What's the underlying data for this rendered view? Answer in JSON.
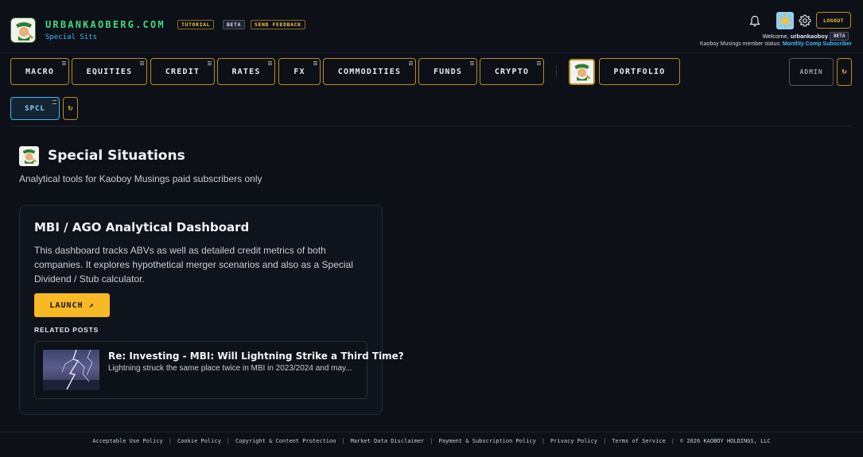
{
  "header": {
    "brand_title": "URBANKAOBERG.COM",
    "brand_subtitle": "Special Sits",
    "badges": {
      "tutorial": "TUTORIAL",
      "beta": "BETA",
      "feedback": "SEND FEEDBACK"
    },
    "logout_label": "LOGOUT",
    "welcome_prefix": "Welcome, ",
    "username": "urbankaoboy",
    "user_badge": "BETA",
    "member_status_prefix": "Kaoboy Musings member status: ",
    "member_status": "Monthly Comp Subscriber",
    "icons": [
      "bell-icon",
      "sun-icon",
      "gear-icon"
    ]
  },
  "nav": {
    "items": [
      "MACRO",
      "EQUITIES",
      "CREDIT",
      "RATES",
      "FX",
      "COMMODITIES",
      "FUNDS",
      "CRYPTO"
    ],
    "portfolio": "PORTFOLIO",
    "admin": "ADMIN",
    "refresh_glyph": "↻"
  },
  "subnav": {
    "active_tab": "SPCL",
    "refresh_glyph": "↻"
  },
  "page": {
    "title": "Special Situations",
    "description": "Analytical tools for Kaoboy Musings paid subscribers only"
  },
  "card": {
    "title": "MBI / AGO Analytical Dashboard",
    "description": "This dashboard tracks ABVs as well as detailed credit metrics of both companies. It explores hypothetical merger scenarios and also as a Special Dividend / Stub calculator.",
    "launch_label": "LAUNCH ↗",
    "related_heading": "RELATED POSTS",
    "post": {
      "title": "Re: Investing - MBI: Will Lightning Strike a Third Time?",
      "excerpt": "Lightning struck the same place twice in MBI in 2023/2024 and may..."
    }
  },
  "footer": {
    "links": [
      "Acceptable Use Policy",
      "Cookie Policy",
      "Copyright & Content Protection",
      "Market Data Disclaimer",
      "Payment & Subscription Policy",
      "Privacy Policy",
      "Terms of Service"
    ],
    "copyright": "© 2026 KAOBOY HOLDINGS, LLC",
    "separator": "|"
  },
  "colors": {
    "accent_gold": "#f7b924",
    "brand_green": "#3ddc84",
    "link_blue": "#38bdf8",
    "background": "#0d1017"
  }
}
